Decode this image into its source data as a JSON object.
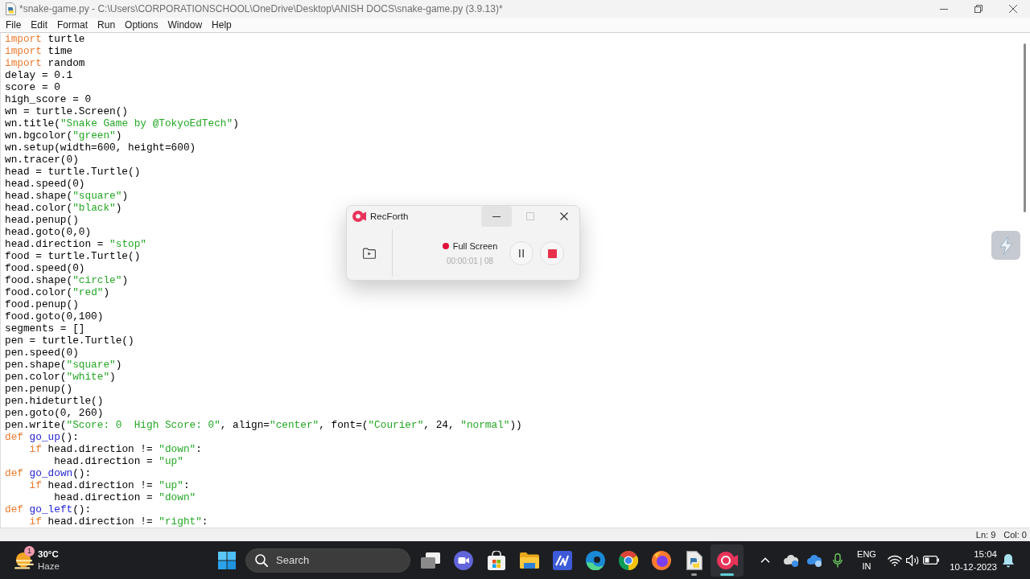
{
  "window": {
    "title": "*snake-game.py - C:\\Users\\CORPORATIONSCHOOL\\OneDrive\\Desktop\\ANISH DOCS\\snake-game.py (3.9.13)*"
  },
  "menu": [
    "File",
    "Edit",
    "Format",
    "Run",
    "Options",
    "Window",
    "Help"
  ],
  "editor": {
    "lines": [
      {
        "tokens": [
          {
            "kind": "keyword",
            "text": "import"
          },
          {
            "kind": "plain",
            "text": " turtle"
          }
        ]
      },
      {
        "tokens": [
          {
            "kind": "keyword",
            "text": "import"
          },
          {
            "kind": "plain",
            "text": " time"
          }
        ]
      },
      {
        "tokens": [
          {
            "kind": "keyword",
            "text": "import"
          },
          {
            "kind": "plain",
            "text": " random"
          }
        ]
      },
      {
        "tokens": [
          {
            "kind": "plain",
            "text": "delay = 0.1"
          }
        ]
      },
      {
        "tokens": [
          {
            "kind": "plain",
            "text": "score = 0"
          }
        ]
      },
      {
        "tokens": [
          {
            "kind": "plain",
            "text": "high_score = 0"
          }
        ]
      },
      {
        "tokens": [
          {
            "kind": "plain",
            "text": "wn = turtle.Screen()"
          }
        ]
      },
      {
        "tokens": [
          {
            "kind": "plain",
            "text": "wn.title("
          },
          {
            "kind": "string",
            "text": "\"Snake Game by @TokyoEdTech\""
          },
          {
            "kind": "plain",
            "text": ")"
          }
        ]
      },
      {
        "tokens": [
          {
            "kind": "plain",
            "text": "wn.bgcolor("
          },
          {
            "kind": "string",
            "text": "\"green\""
          },
          {
            "kind": "plain",
            "text": ")"
          }
        ]
      },
      {
        "tokens": [
          {
            "kind": "plain",
            "text": "wn.setup(width=600, height=600)"
          }
        ]
      },
      {
        "tokens": [
          {
            "kind": "plain",
            "text": "wn.tracer(0)"
          }
        ]
      },
      {
        "tokens": [
          {
            "kind": "plain",
            "text": "head = turtle.Turtle()"
          }
        ]
      },
      {
        "tokens": [
          {
            "kind": "plain",
            "text": "head.speed(0)"
          }
        ]
      },
      {
        "tokens": [
          {
            "kind": "plain",
            "text": "head.shape("
          },
          {
            "kind": "string",
            "text": "\"square\""
          },
          {
            "kind": "plain",
            "text": ")"
          }
        ]
      },
      {
        "tokens": [
          {
            "kind": "plain",
            "text": "head.color("
          },
          {
            "kind": "string",
            "text": "\"black\""
          },
          {
            "kind": "plain",
            "text": ")"
          }
        ]
      },
      {
        "tokens": [
          {
            "kind": "plain",
            "text": "head.penup()"
          }
        ]
      },
      {
        "tokens": [
          {
            "kind": "plain",
            "text": "head.goto(0,0)"
          }
        ]
      },
      {
        "tokens": [
          {
            "kind": "plain",
            "text": "head.direction = "
          },
          {
            "kind": "string",
            "text": "\"stop\""
          }
        ]
      },
      {
        "tokens": [
          {
            "kind": "plain",
            "text": "food = turtle.Turtle()"
          }
        ]
      },
      {
        "tokens": [
          {
            "kind": "plain",
            "text": "food.speed(0)"
          }
        ]
      },
      {
        "tokens": [
          {
            "kind": "plain",
            "text": "food.shape("
          },
          {
            "kind": "string",
            "text": "\"circle\""
          },
          {
            "kind": "plain",
            "text": ")"
          }
        ]
      },
      {
        "tokens": [
          {
            "kind": "plain",
            "text": "food.color("
          },
          {
            "kind": "string",
            "text": "\"red\""
          },
          {
            "kind": "plain",
            "text": ")"
          }
        ]
      },
      {
        "tokens": [
          {
            "kind": "plain",
            "text": "food.penup()"
          }
        ]
      },
      {
        "tokens": [
          {
            "kind": "plain",
            "text": "food.goto(0,100)"
          }
        ]
      },
      {
        "tokens": [
          {
            "kind": "plain",
            "text": "segments = []"
          }
        ]
      },
      {
        "tokens": [
          {
            "kind": "plain",
            "text": "pen = turtle.Turtle()"
          }
        ]
      },
      {
        "tokens": [
          {
            "kind": "plain",
            "text": "pen.speed(0)"
          }
        ]
      },
      {
        "tokens": [
          {
            "kind": "plain",
            "text": "pen.shape("
          },
          {
            "kind": "string",
            "text": "\"square\""
          },
          {
            "kind": "plain",
            "text": ")"
          }
        ]
      },
      {
        "tokens": [
          {
            "kind": "plain",
            "text": "pen.color("
          },
          {
            "kind": "string",
            "text": "\"white\""
          },
          {
            "kind": "plain",
            "text": ")"
          }
        ]
      },
      {
        "tokens": [
          {
            "kind": "plain",
            "text": "pen.penup()"
          }
        ]
      },
      {
        "tokens": [
          {
            "kind": "plain",
            "text": "pen.hideturtle()"
          }
        ]
      },
      {
        "tokens": [
          {
            "kind": "plain",
            "text": "pen.goto(0, 260)"
          }
        ]
      },
      {
        "tokens": [
          {
            "kind": "plain",
            "text": "pen.write("
          },
          {
            "kind": "string",
            "text": "\"Score: 0  High Score: 0\""
          },
          {
            "kind": "plain",
            "text": ", align="
          },
          {
            "kind": "string",
            "text": "\"center\""
          },
          {
            "kind": "plain",
            "text": ", font=("
          },
          {
            "kind": "string",
            "text": "\"Courier\""
          },
          {
            "kind": "plain",
            "text": ", 24, "
          },
          {
            "kind": "string",
            "text": "\"normal\""
          },
          {
            "kind": "plain",
            "text": "))"
          }
        ]
      },
      {
        "tokens": [
          {
            "kind": "keyword",
            "text": "def"
          },
          {
            "kind": "name",
            "text": " go_up"
          },
          {
            "kind": "plain",
            "text": "():"
          }
        ]
      },
      {
        "tokens": [
          {
            "kind": "keyword",
            "text": "    if"
          },
          {
            "kind": "plain",
            "text": " head.direction != "
          },
          {
            "kind": "string",
            "text": "\"down\""
          },
          {
            "kind": "plain",
            "text": ":"
          }
        ]
      },
      {
        "tokens": [
          {
            "kind": "plain",
            "text": "        head.direction = "
          },
          {
            "kind": "string",
            "text": "\"up\""
          }
        ]
      },
      {
        "tokens": [
          {
            "kind": "keyword",
            "text": "def"
          },
          {
            "kind": "name",
            "text": " go_down"
          },
          {
            "kind": "plain",
            "text": "():"
          }
        ]
      },
      {
        "tokens": [
          {
            "kind": "keyword",
            "text": "    if"
          },
          {
            "kind": "plain",
            "text": " head.direction != "
          },
          {
            "kind": "string",
            "text": "\"up\""
          },
          {
            "kind": "plain",
            "text": ":"
          }
        ]
      },
      {
        "tokens": [
          {
            "kind": "plain",
            "text": "        head.direction = "
          },
          {
            "kind": "string",
            "text": "\"down\""
          }
        ]
      },
      {
        "tokens": [
          {
            "kind": "keyword",
            "text": "def"
          },
          {
            "kind": "name",
            "text": " go_left"
          },
          {
            "kind": "plain",
            "text": "():"
          }
        ]
      },
      {
        "tokens": [
          {
            "kind": "keyword",
            "text": "    if"
          },
          {
            "kind": "plain",
            "text": " head.direction != "
          },
          {
            "kind": "string",
            "text": "\"right\""
          },
          {
            "kind": "plain",
            "text": ":"
          }
        ]
      }
    ]
  },
  "status_bar": {
    "line": "Ln: 9",
    "column": "Col: 0"
  },
  "recorder": {
    "title": "RecForth",
    "window_controls": [
      {
        "kind": "minimize",
        "hovered": true,
        "disabled": false
      },
      {
        "kind": "maximize",
        "hovered": false,
        "disabled": true
      },
      {
        "kind": "close",
        "hovered": false,
        "disabled": false
      }
    ],
    "recording": true,
    "mode": "Full Screen",
    "timer": "00:00:01 | 08"
  },
  "taskbar": {
    "weather": {
      "badge": "1",
      "temperature": "30°C",
      "condition": "Haze"
    },
    "search": {
      "placeholder": "Search"
    },
    "apps": [
      {
        "kind": "taskview",
        "running": false,
        "selected": false
      },
      {
        "kind": "meet",
        "running": false,
        "selected": false
      },
      {
        "kind": "store",
        "running": false,
        "selected": false
      },
      {
        "kind": "files",
        "running": false,
        "selected": false
      },
      {
        "kind": "studio",
        "running": false,
        "selected": false
      },
      {
        "kind": "edge",
        "running": false,
        "selected": false
      },
      {
        "kind": "chrome",
        "running": false,
        "selected": false
      },
      {
        "kind": "firefox",
        "running": false,
        "selected": false
      },
      {
        "kind": "idle",
        "running": true,
        "selected": false
      },
      {
        "kind": "recorder",
        "running": true,
        "selected": true
      }
    ],
    "tray": {
      "language": "ENG",
      "region": "IN",
      "time": "15:04",
      "date": "10-12-2023"
    }
  }
}
